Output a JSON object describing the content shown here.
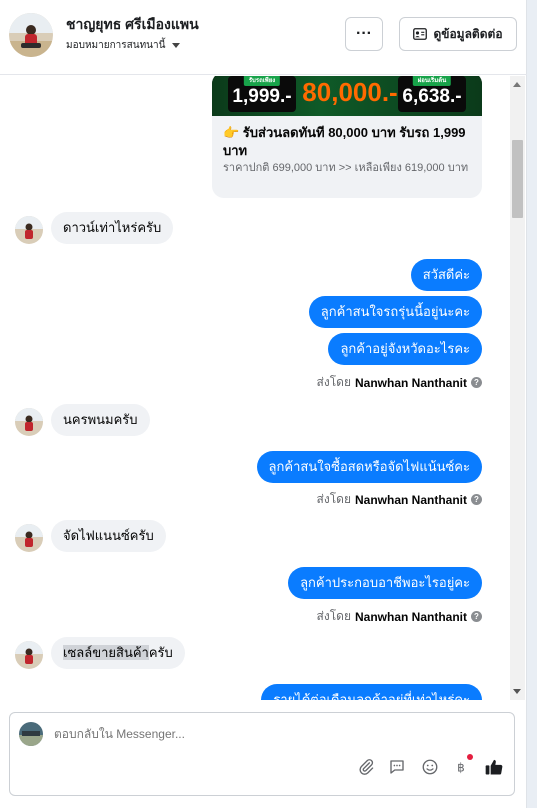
{
  "header": {
    "name": "ชาญยุทธ ศรีเมืองแพน",
    "assigned_to": "มอบหมายการสนทนานี้",
    "more_label": "···",
    "contact_label": "ดูข้อมูลติดต่อ"
  },
  "promo": {
    "tag_left": "รับรถเพียง",
    "price_left": "1,999.-",
    "price_mid": "80,000.-",
    "tag_right": "ผ่อนเริ่มต้น",
    "price_right": "6,638.-",
    "title": "👉 รับส่วนลดทันที 80,000 บาท รับรถ 1,999 บาท",
    "description": "ราคาปกติ 699,000 บาท  >>  เหลือเพียง 619,000 บาท"
  },
  "messages": [
    {
      "dir": "in",
      "text": "ดาวน์เท่าไหร่ครับ"
    },
    {
      "dir": "out",
      "text": "สวัสดีค่ะ"
    },
    {
      "dir": "out",
      "text": "ลูกค้าสนใจรถรุ่นนี้อยู่นะคะ"
    },
    {
      "dir": "out",
      "text": "ลูกค้าอยู่จังหวัดอะไรคะ"
    },
    {
      "dir": "in",
      "text": "นครพนมครับ"
    },
    {
      "dir": "out",
      "text": "ลูกค้าสนใจซื้อสดหรือจัดไฟแน้นซ์คะ"
    },
    {
      "dir": "in",
      "text": "จัดไฟแนนซ์ครับ"
    },
    {
      "dir": "out",
      "text": "ลูกค้าประกอบอาชีพอะไรอยู่คะ"
    },
    {
      "dir": "in",
      "text_highlight": "เซลล์ขายสินค้า",
      "text_rest": "ครับ"
    },
    {
      "dir": "out",
      "text": "รายได้ต่อเดือนลูกค้าอยู่ที่เท่าไหร่คะ"
    }
  ],
  "sent_by": {
    "prefix": "ส่งโดย",
    "agent": "Nanwhan Nanthanit",
    "help": "?"
  },
  "composer": {
    "placeholder": "ตอบกลับใน Messenger..."
  },
  "icons": {
    "attach": "paperclip-icon",
    "quick_reply": "chat-bubble-icon",
    "emoji": "smiley-icon",
    "payment": "baht-icon",
    "like": "thumbs-up-icon"
  },
  "colors": {
    "outgoing_bubble": "#0a7cff",
    "incoming_bubble": "#f0f2f5",
    "notification_dot": "#e41e3f"
  }
}
